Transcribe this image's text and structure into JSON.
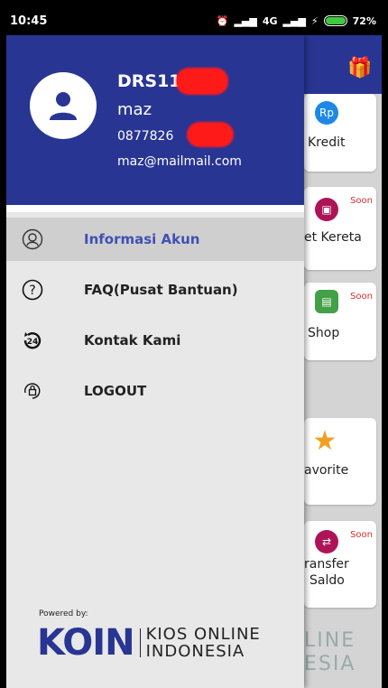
{
  "status_bar": {
    "time": "10:45",
    "network": "4G",
    "battery": "72%"
  },
  "drawer": {
    "user": {
      "code": "DRS11",
      "name": "maz",
      "phone": "0877826",
      "email": "maz@mailmail.com"
    },
    "menu": [
      {
        "label": "Informasi Akun",
        "icon": "person-circle-icon",
        "active": true
      },
      {
        "label": "FAQ(Pusat Bantuan)",
        "icon": "question-circle-icon"
      },
      {
        "label": "Kontak Kami",
        "icon": "24h-support-icon"
      },
      {
        "label": "LOGOUT",
        "icon": "lock-icon"
      }
    ],
    "footer": {
      "powered_by": "Powered by:",
      "brand": "KOIN",
      "brand_sub_1": "KIOS ONLINE",
      "brand_sub_2": "INDONESIA"
    }
  },
  "background": {
    "cards": [
      {
        "label": "Kredit",
        "soon": ""
      },
      {
        "label": "et Kereta",
        "soon": "Soon"
      },
      {
        "label": "Shop",
        "soon": "Soon"
      },
      {
        "label": "avorite",
        "soon": ""
      },
      {
        "label": "ransfer",
        "label2": "Saldo",
        "soon": "Soon"
      }
    ],
    "brand_1": "LINE",
    "brand_2": "ESIA"
  }
}
